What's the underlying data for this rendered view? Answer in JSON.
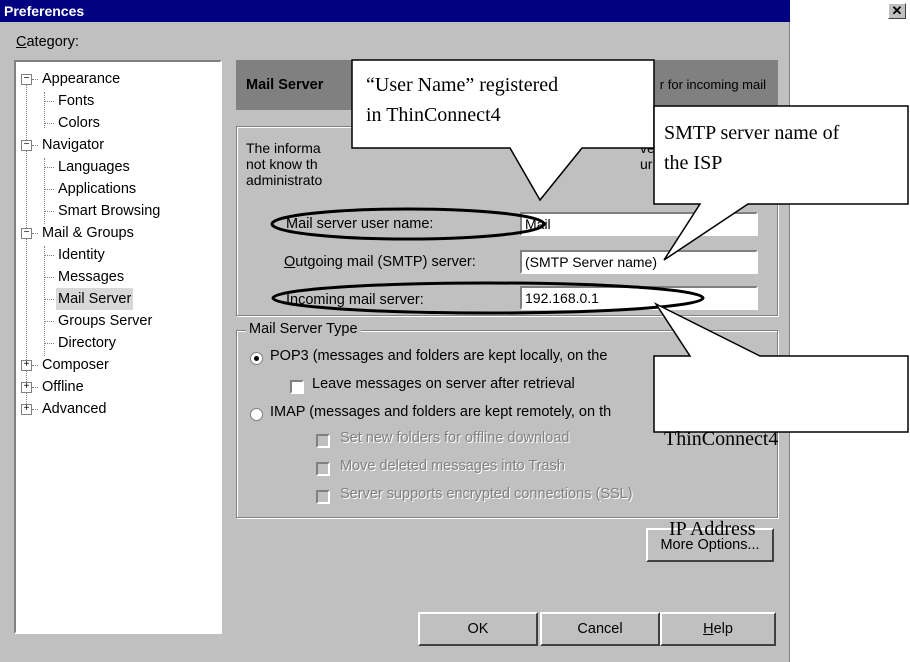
{
  "window": {
    "title": "Preferences",
    "close_glyph": "✕"
  },
  "category_label": "Category:",
  "tree": [
    {
      "label": "Appearance",
      "toggle": "−"
    },
    {
      "label": "Fonts"
    },
    {
      "label": "Colors"
    },
    {
      "label": "Navigator",
      "toggle": "−"
    },
    {
      "label": "Languages"
    },
    {
      "label": "Applications"
    },
    {
      "label": "Smart Browsing"
    },
    {
      "label": "Mail & Groups",
      "toggle": "−"
    },
    {
      "label": "Identity"
    },
    {
      "label": "Messages"
    },
    {
      "label": "Mail Server",
      "selected": true
    },
    {
      "label": "Groups Server"
    },
    {
      "label": "Directory"
    },
    {
      "label": "Composer",
      "toggle": "+"
    },
    {
      "label": "Offline",
      "toggle": "+"
    },
    {
      "label": "Advanced",
      "toggle": "+"
    }
  ],
  "panel": {
    "title": "Mail Server",
    "subtitle_fragment": "r for incoming mail",
    "info_lines": [
      "The informa",
      "not know th",
      "administrato"
    ],
    "info_right": [
      "ve",
      "ur"
    ],
    "fields": {
      "username_label": "Mail server user name:",
      "username_value": "Mail",
      "smtp_label": "Outgoing mail (SMTP) server:",
      "smtp_value": "(SMTP Server name)",
      "incoming_label": "Incoming mail server:",
      "incoming_value": "192.168.0.1"
    },
    "server_type": {
      "legend": "Mail Server Type",
      "pop3_label": "POP3 (messages and folders are kept locally, on the",
      "leave_label": "Leave messages on server after retrieval",
      "imap_label": "IMAP (messages and folders are kept remotely, on th",
      "set_new_folders": "Set new folders for offline download",
      "move_deleted": "Move deleted messages into Trash",
      "ssl": "Server supports encrypted connections (SSL)"
    },
    "more_options": "More Options..."
  },
  "buttons": {
    "ok": "OK",
    "cancel": "Cancel",
    "help": "Help"
  },
  "callouts": {
    "username": [
      "“User Name” registered",
      "in ThinConnect4"
    ],
    "smtp": [
      "SMTP server name of",
      "the ISP"
    ],
    "ip": [
      "ThinConnect4",
      " IP Address"
    ]
  }
}
